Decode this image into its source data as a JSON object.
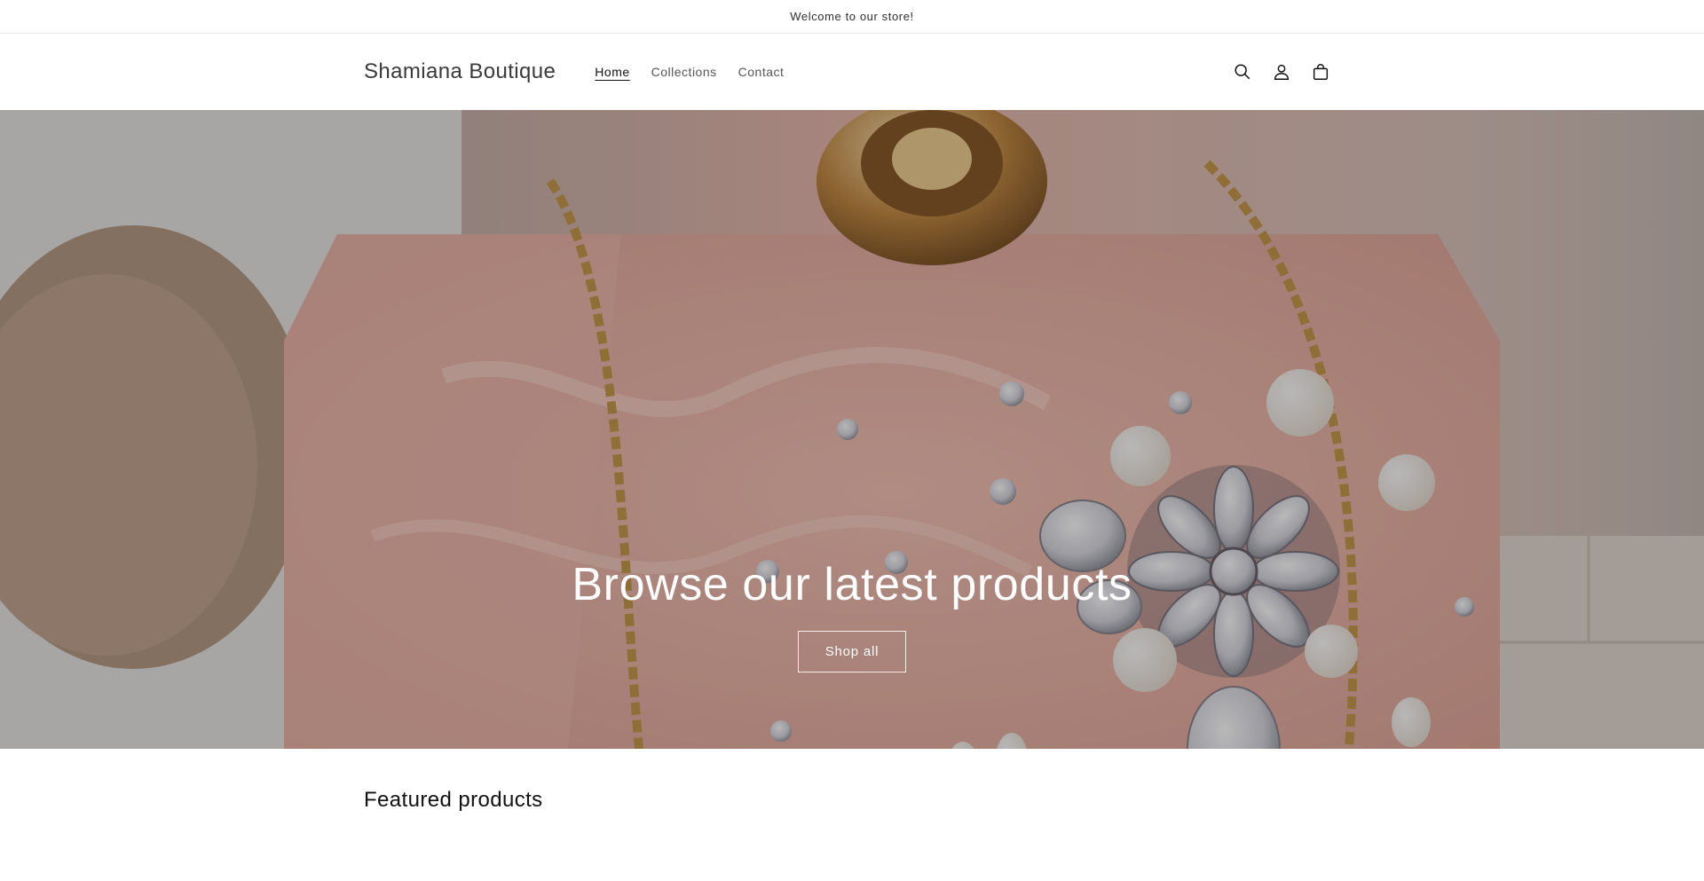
{
  "announcement": {
    "text": "Welcome to our store!"
  },
  "header": {
    "brand": "Shamiana Boutique",
    "nav": [
      {
        "label": "Home",
        "active": true
      },
      {
        "label": "Collections",
        "active": false
      },
      {
        "label": "Contact",
        "active": false
      }
    ],
    "icons": [
      "search-icon",
      "account-icon",
      "cart-icon"
    ]
  },
  "hero": {
    "title": "Browse our latest products",
    "cta_label": "Shop all"
  },
  "featured": {
    "title": "Featured products"
  },
  "colors": {
    "text": "#121212",
    "hero_overlay": "rgba(0,0,0,0.28)",
    "border": "#e6e6e6"
  }
}
